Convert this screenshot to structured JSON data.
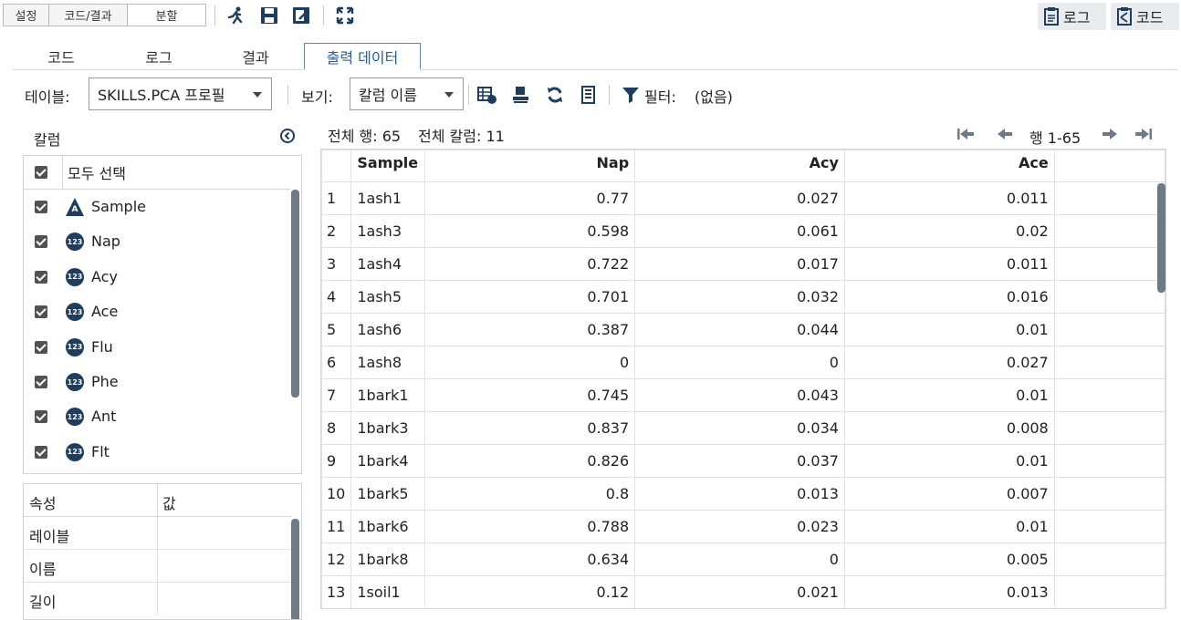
{
  "toolbar": {
    "segments": [
      "설정",
      "코드/결과",
      "분할"
    ],
    "right_buttons": {
      "log": "로그",
      "code": "코드"
    }
  },
  "tabs": [
    "코드",
    "로그",
    "결과",
    "출력 데이터"
  ],
  "active_tab": "출력 데이터",
  "data_toolbar": {
    "table_label": "테이블:",
    "table_value": "SKILLS.PCA 프로필",
    "view_label": "보기:",
    "view_value": "칼럼 이름",
    "filter_label": "필터:",
    "filter_value": "(없음)"
  },
  "columns_panel": {
    "title": "칼럼",
    "select_all": "모두 선택",
    "items": [
      {
        "name": "Sample",
        "type": "char",
        "icon": "A"
      },
      {
        "name": "Nap",
        "type": "num",
        "icon": "123"
      },
      {
        "name": "Acy",
        "type": "num",
        "icon": "123"
      },
      {
        "name": "Ace",
        "type": "num",
        "icon": "123"
      },
      {
        "name": "Flu",
        "type": "num",
        "icon": "123"
      },
      {
        "name": "Phe",
        "type": "num",
        "icon": "123"
      },
      {
        "name": "Ant",
        "type": "num",
        "icon": "123"
      },
      {
        "name": "Flt",
        "type": "num",
        "icon": "123"
      }
    ]
  },
  "props_panel": {
    "headers": [
      "속성",
      "값"
    ],
    "rows": [
      "레이블",
      "이름",
      "길이"
    ]
  },
  "summary": {
    "total_rows": "전체 행: 65",
    "total_cols": "전체 칼럼: 11",
    "row_range": "행 1-65"
  },
  "grid": {
    "headers": [
      "Sample",
      "Nap",
      "Acy",
      "Ace"
    ],
    "rows": [
      [
        "1",
        "1ash1",
        "0.77",
        "0.027",
        "0.011"
      ],
      [
        "2",
        "1ash3",
        "0.598",
        "0.061",
        "0.02"
      ],
      [
        "3",
        "1ash4",
        "0.722",
        "0.017",
        "0.011"
      ],
      [
        "4",
        "1ash5",
        "0.701",
        "0.032",
        "0.016"
      ],
      [
        "5",
        "1ash6",
        "0.387",
        "0.044",
        "0.01"
      ],
      [
        "6",
        "1ash8",
        "0",
        "0",
        "0.027"
      ],
      [
        "7",
        "1bark1",
        "0.745",
        "0.043",
        "0.01"
      ],
      [
        "8",
        "1bark3",
        "0.837",
        "0.034",
        "0.008"
      ],
      [
        "9",
        "1bark4",
        "0.826",
        "0.037",
        "0.01"
      ],
      [
        "10",
        "1bark5",
        "0.8",
        "0.013",
        "0.007"
      ],
      [
        "11",
        "1bark6",
        "0.788",
        "0.023",
        "0.01"
      ],
      [
        "12",
        "1bark8",
        "0.634",
        "0",
        "0.005"
      ],
      [
        "13",
        "1soil1",
        "0.12",
        "0.021",
        "0.013"
      ]
    ]
  },
  "colors": {
    "accent": "#1e5fa8",
    "tab_border": "#4b8bd1",
    "icon_navy": "#1f3d5c"
  }
}
